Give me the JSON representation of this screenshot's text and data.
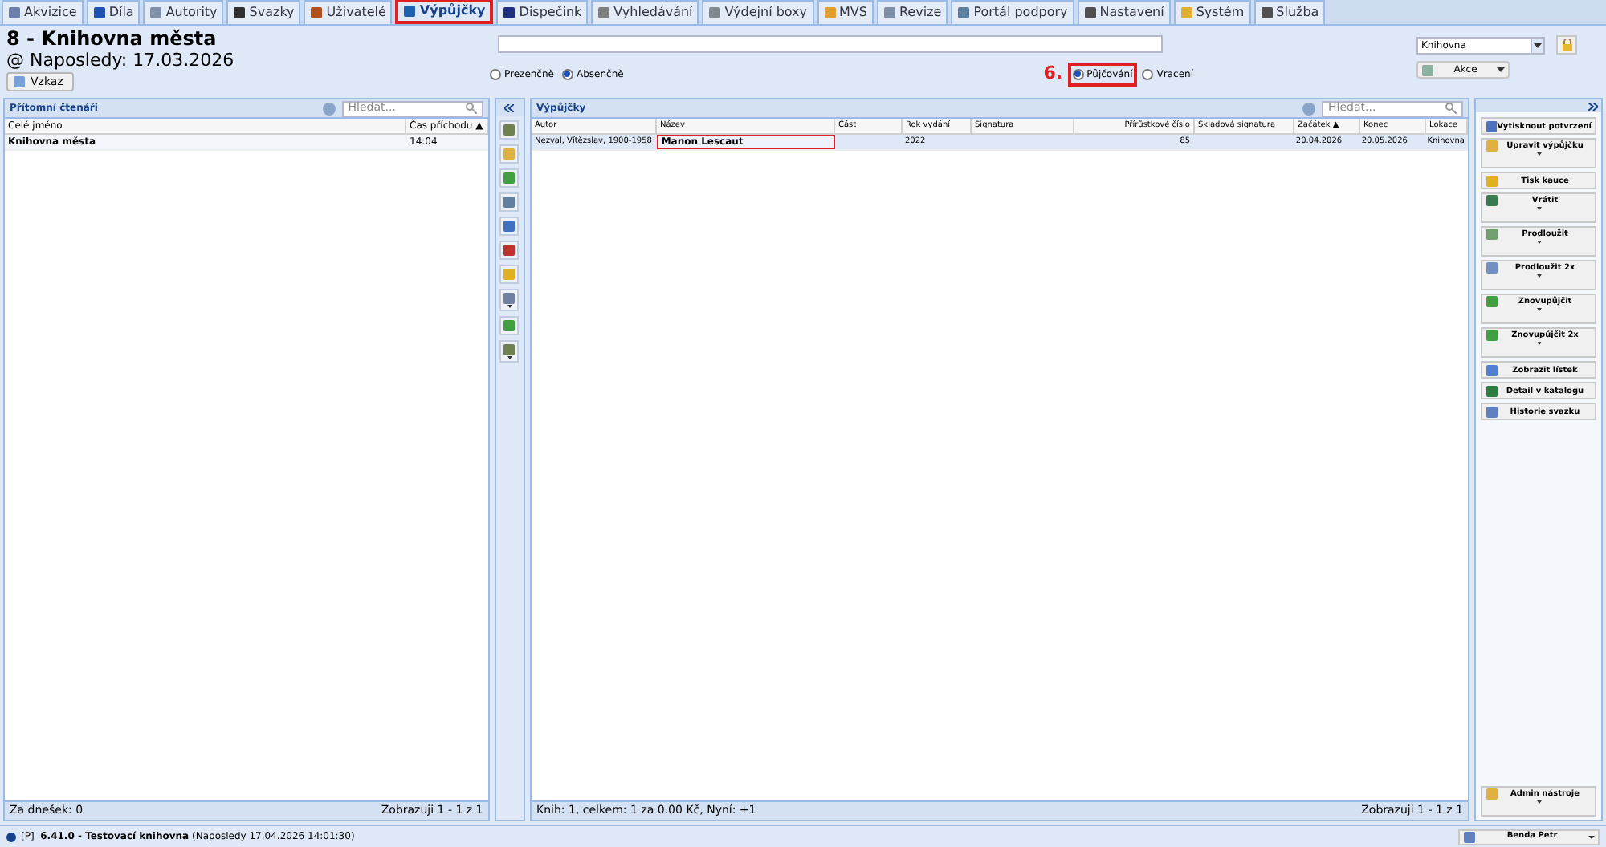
{
  "tabs": [
    {
      "label": "Akvizice",
      "selected": false,
      "highlighted": false
    },
    {
      "label": "Díla",
      "selected": false,
      "highlighted": false
    },
    {
      "label": "Autority",
      "selected": false,
      "highlighted": false
    },
    {
      "label": "Svazky",
      "selected": false,
      "highlighted": false
    },
    {
      "label": "Uživatelé",
      "selected": false,
      "highlighted": false
    },
    {
      "label": "Výpůjčky",
      "selected": true,
      "highlighted": true
    },
    {
      "label": "Dispečink",
      "selected": false,
      "highlighted": false
    },
    {
      "label": "Vyhledávání",
      "selected": false,
      "highlighted": false
    },
    {
      "label": "Výdejní boxy",
      "selected": false,
      "highlighted": false
    },
    {
      "label": "MVS",
      "selected": false,
      "highlighted": false
    },
    {
      "label": "Revize",
      "selected": false,
      "highlighted": false
    },
    {
      "label": "Portál podpory",
      "selected": false,
      "highlighted": false
    },
    {
      "label": "Nastavení",
      "selected": false,
      "highlighted": false
    },
    {
      "label": "Systém",
      "selected": false,
      "highlighted": false
    },
    {
      "label": "Služba",
      "selected": false,
      "highlighted": false
    }
  ],
  "header": {
    "title": "8 - Knihovna města",
    "subtitle": "@ Naposledy: 17.03.2026",
    "message_button": "Vzkaz"
  },
  "mode_radios": [
    {
      "label": "Prezenčně",
      "selected": false
    },
    {
      "label": "Absenčně",
      "selected": true
    }
  ],
  "annotation": "6.",
  "direction_radios": [
    {
      "label": "Půjčování",
      "selected": true,
      "highlighted": true
    },
    {
      "label": "Vracení",
      "selected": false,
      "highlighted": false
    }
  ],
  "location_select": {
    "value": "Knihovna"
  },
  "actions_button": "Akce",
  "readers_panel": {
    "title": "Přítomní čtenáři",
    "search_placeholder": "Hledat...",
    "columns": [
      "Celé jméno",
      "Čas příchodu ▲"
    ],
    "rows": [
      [
        "Knihovna města",
        "14:04"
      ]
    ],
    "footer_left": "Za dnešek: 0",
    "footer_right": "Zobrazuji 1 - 1 z 1"
  },
  "toolbar": [
    {
      "menu": false
    },
    {
      "menu": false
    },
    {
      "menu": false
    },
    {
      "menu": false
    },
    {
      "menu": false
    },
    {
      "menu": false
    },
    {
      "menu": false
    },
    {
      "menu": true
    },
    {
      "menu": false
    },
    {
      "menu": true
    }
  ],
  "loans_panel": {
    "title": "Výpůjčky",
    "search_placeholder": "Hledat...",
    "columns": [
      "Autor",
      "Název",
      "Část",
      "Rok vydání",
      "Signatura",
      "Přírůstkové číslo",
      "Skladová signatura",
      "Začátek ▲",
      "Konec",
      "Lokace"
    ],
    "rows": [
      [
        {
          "text": "Nezval, Vítězslav, 1900-1958",
          "highlighted": false
        },
        {
          "text": "Manon Lescaut",
          "highlighted": true
        },
        {
          "text": "",
          "highlighted": false
        },
        {
          "text": "2022",
          "highlighted": false
        },
        {
          "text": "",
          "highlighted": false
        },
        {
          "text": "85",
          "highlighted": false
        },
        {
          "text": "",
          "highlighted": false
        },
        {
          "text": "20.04.2026",
          "highlighted": false
        },
        {
          "text": "20.05.2026",
          "highlighted": false
        },
        {
          "text": "Knihovna",
          "highlighted": false
        }
      ]
    ],
    "footer_left": "Knih: 1, celkem: 1 za 0.00 Kč, Nyní: +1",
    "footer_right": "Zobrazuji 1 - 1 z 1"
  },
  "side_actions": [
    {
      "label": "Vytisknout potvrzení",
      "menu": false
    },
    {
      "label": "Upravit výpůjčku",
      "menu": true
    },
    {
      "label": "Tisk kauce",
      "menu": false
    },
    {
      "label": "Vrátit",
      "menu": true
    },
    {
      "label": "Prodloužit",
      "menu": true
    },
    {
      "label": "Prodloužit 2x",
      "menu": true
    },
    {
      "label": "Znovupůjčit",
      "menu": true
    },
    {
      "label": "Znovupůjčit 2x",
      "menu": true
    },
    {
      "label": "Zobrazit lístek",
      "menu": false
    },
    {
      "label": "Detail v katalogu",
      "menu": false
    },
    {
      "label": "Historie svazku",
      "menu": false
    }
  ],
  "admin_button": {
    "label": "Admin nástroje",
    "menu": true
  },
  "status_bar": {
    "text": "[P]  **6.41.0 - Testovací knihovna** (Naposledy 17.04.2026 14:01:30)",
    "user": "Benda Petr"
  }
}
